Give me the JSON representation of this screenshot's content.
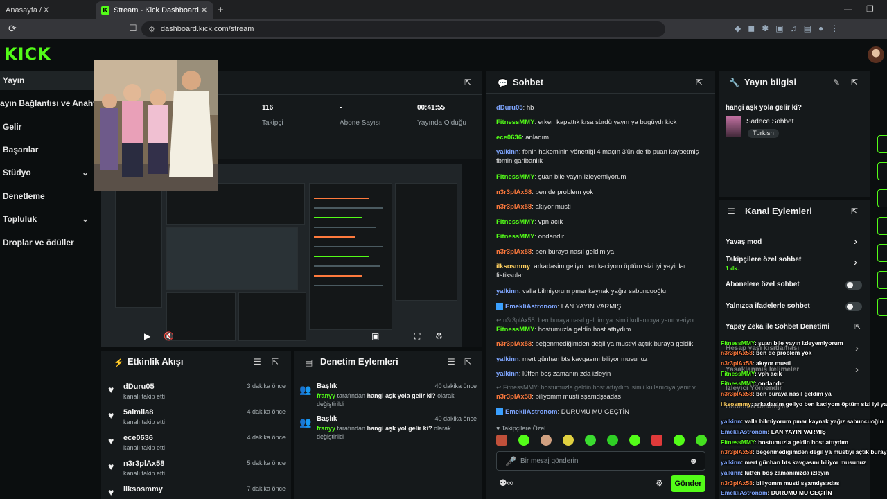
{
  "browser": {
    "tabs": [
      {
        "label": "Anasayfa / X",
        "active": false
      },
      {
        "label": "Stream - Kick Dashboard",
        "active": true
      }
    ],
    "url": "dashboard.kick.com/stream"
  },
  "brand": {
    "logo": "KICK",
    "accent": "#53fc18"
  },
  "sidebar": {
    "items": [
      {
        "label": "Yayın",
        "active": true
      },
      {
        "label": "ayın Bağlantısı ve Anahtarı"
      },
      {
        "label": "Gelir"
      },
      {
        "label": "Başarılar"
      },
      {
        "label": "Stüdyo",
        "chevron": "chevron-down-icon"
      },
      {
        "label": "Denetleme"
      },
      {
        "label": "Topluluk",
        "chevron": "chevron-down-icon"
      },
      {
        "label": "Droplar ve ödüller"
      }
    ]
  },
  "stats": {
    "followers_value": "116",
    "followers_label": "Takipçi",
    "subs_value": "-",
    "subs_label": "Abone Sayısı",
    "duration_value": "00:41:55",
    "duration_label": "Yayında Olduğu Süre"
  },
  "activity": {
    "title": "Etkinlik Akışı",
    "items": [
      {
        "user": "dDuru05",
        "action": "kanalı takip etti",
        "time": "3 dakika önce"
      },
      {
        "user": "5almila8",
        "action": "kanalı takip etti",
        "time": "4 dakika önce"
      },
      {
        "user": "ece0636",
        "action": "kanalı takip etti",
        "time": "4 dakika önce"
      },
      {
        "user": "n3r3plAx58",
        "action": "kanalı takip etti",
        "time": "5 dakika önce"
      },
      {
        "user": "ilksosmmy",
        "action": "",
        "time": "7 dakika önce"
      }
    ]
  },
  "moderation": {
    "title": "Denetim Eylemleri",
    "items": [
      {
        "title": "Başlık",
        "time": "40 dakika önce",
        "actor": "franyy",
        "by": "tarafından",
        "value": "hangi aşk yola gelir ki?",
        "suffix": "olarak değiştirildi"
      },
      {
        "title": "Başlık",
        "time": "40 dakika önce",
        "actor": "franyy",
        "by": "tarafından",
        "value": "hangi aşk yol gelir ki?",
        "suffix": "olarak değiştirildi"
      }
    ]
  },
  "chat": {
    "title": "Sohbet",
    "messages": [
      {
        "user": "dDuru05",
        "color": "#7fa6ff",
        "text": "hb"
      },
      {
        "user": "FitnessMMY",
        "color": "#53fc18",
        "text": "erken kapattık kısa sürdü yayın ya bugüydı kick"
      },
      {
        "user": "ece0636",
        "color": "#53fc18",
        "text": "anladım"
      },
      {
        "user": "yalkinn",
        "color": "#7fa6ff",
        "text": "fbnin hakeminin yönettiği 4 maçın 3'ün de fb puan kaybetmiş fbmin garibanlık"
      },
      {
        "user": "FitnessMMY",
        "color": "#53fc18",
        "text": "şuan bile yayın izleyemiyorum"
      },
      {
        "user": "n3r3plAx58",
        "color": "#ff7a3d",
        "text": "ben de problem yok"
      },
      {
        "user": "n3r3plAx58",
        "color": "#ff7a3d",
        "text": "akıyor musti"
      },
      {
        "user": "FitnessMMY",
        "color": "#53fc18",
        "text": "vpn acık"
      },
      {
        "user": "FitnessMMY",
        "color": "#53fc18",
        "text": "ondandır"
      },
      {
        "user": "n3r3plAx58",
        "color": "#ff7a3d",
        "text": "ben buraya nasıl geldim ya"
      },
      {
        "user": "ilksosmmy",
        "color": "#ffd060",
        "text": "arkadasim geliyo ben kaciyom öptüm sizi iyi yayinlar fistiksular"
      },
      {
        "user": "yalkinn",
        "color": "#7fa6ff",
        "text": "valla bilmiyorum pınar kaynak yağız sabuncuoğlu"
      },
      {
        "user": "EmekliAstronom",
        "color": "#7fa6ff",
        "text": "LAN YAYIN VARMIŞ"
      },
      {
        "reply": "n3r3plAx58: ben buraya nasıl geldim ya isimli kullanıcıya yanıt veriyor"
      },
      {
        "user": "FitnessMMY",
        "color": "#53fc18",
        "text": "hostumuzla geldin host attıydım"
      },
      {
        "user": "n3r3plAx58",
        "color": "#ff7a3d",
        "text": "beğenmediğimden değil ya mustiyi açtık buraya geldik"
      },
      {
        "user": "yalkinn",
        "color": "#7fa6ff",
        "text": "mert günhan bts kavgasını biliyor musunuz"
      },
      {
        "user": "yalkinn",
        "color": "#7fa6ff",
        "text": "lütfen boş zamanınızda izleyin"
      },
      {
        "reply": "FitnessMMY: hostumuzla geldin host attıydım isimli kullanıcıya yanıt v..."
      },
      {
        "user": "n3r3plAx58",
        "color": "#ff7a3d",
        "text": "biliyomm musti sşamdşsadas"
      },
      {
        "user": "EmekliAstronom",
        "color": "#7fa6ff",
        "text": "DURUMU MU GEÇTİN"
      }
    ],
    "followers_only": "Takipçilere Özel",
    "input_placeholder": "Bir mesaj gönderin",
    "send_label": "Gönder"
  },
  "stream_info": {
    "title": "Yayın bilgisi",
    "stream_title": "hangi aşk yola gelir ki?",
    "category": "Sadece Sohbet",
    "language": "Turkish"
  },
  "channel_actions": {
    "title": "Kanal Eylemleri",
    "slow_mode": "Yavaş mod",
    "followers_only": "Takipçilere özel sohbet",
    "followers_only_duration": "1 dk.",
    "subscribers_only": "Abonelere özel sohbet",
    "emotes_only": "Yalnızca ifadelerle sohbet",
    "ai_moderation": "Yapay Zeka ile Sohbet Denetimi",
    "account_age": "Hesap yaşı kısıtlaması",
    "banned_words": "Yasaklanmış kelimeler",
    "viewer_settings": "İzleyici Yönlendir",
    "blocked": "Hedefleri belirleyin"
  },
  "overlay_chat": [
    {
      "user": "FitnessMMY",
      "color": "#53fc18",
      "text": ": şuan bile yayın izleyemiyorum"
    },
    {
      "user": "n3r3plAx58",
      "color": "#ff7a3d",
      "text": ": ben de problem yok"
    },
    {
      "user": "n3r3plAx58",
      "color": "#ff7a3d",
      "text": ": akıyor musti"
    },
    {
      "user": "FitnessMMY",
      "color": "#53fc18",
      "text": ": vpn acık"
    },
    {
      "user": "FitnessMMY",
      "color": "#53fc18",
      "text": ": ondandır"
    },
    {
      "user": "n3r3plAx58",
      "color": "#ff7a3d",
      "text": ": ben buraya nasıl geldim ya"
    },
    {
      "user": "ilksosmmy",
      "color": "#ffd060",
      "text": ": arkadasim geliyo ben kaciyom öptüm sizi iyi yayinlar"
    },
    {
      "user": "yalkinn",
      "color": "#7fa6ff",
      "text": ": valla bilmiyorum pınar kaynak yağız sabuncuoğlu"
    },
    {
      "user": "EmekliAstronom",
      "color": "#7fa6ff",
      "text": ": LAN YAYIN VARMIŞ"
    },
    {
      "user": "FitnessMMY",
      "color": "#53fc18",
      "text": ": hostumuzla geldin host attıydım"
    },
    {
      "user": "n3r3plAx58",
      "color": "#ff7a3d",
      "text": ": beğenmediğimden değil ya mustiyi açtık buraya geldik"
    },
    {
      "user": "yalkinn",
      "color": "#7fa6ff",
      "text": ": mert günhan bts kavgasını biliyor musunuz"
    },
    {
      "user": "yalkinn",
      "color": "#7fa6ff",
      "text": ": lütfen boş zamanınızda izleyin"
    },
    {
      "user": "n3r3plAx58",
      "color": "#ff7a3d",
      "text": ": biliyomm musti sşamdşsadas"
    },
    {
      "user": "EmekliAstronom",
      "color": "#7fa6ff",
      "text": ": DURUMU MU GEÇTİN"
    }
  ]
}
